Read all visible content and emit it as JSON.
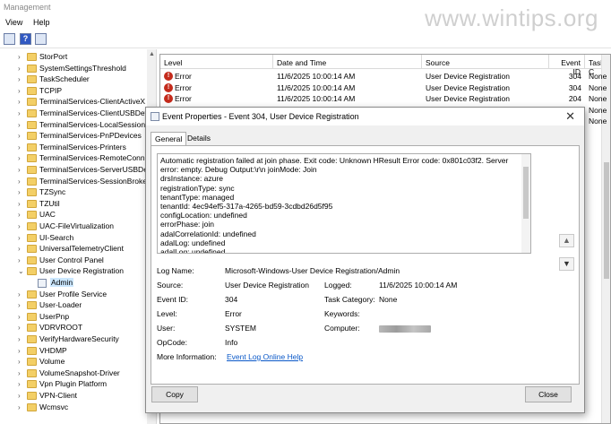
{
  "window": {
    "title": "Management"
  },
  "menu": {
    "view": "View",
    "help": "Help"
  },
  "watermark": "www.wintips.org",
  "tree": {
    "items": [
      {
        "label": "StorPort",
        "expanded": false
      },
      {
        "label": "SystemSettingsThreshold",
        "expanded": false
      },
      {
        "label": "TaskScheduler",
        "expanded": false
      },
      {
        "label": "TCPIP",
        "expanded": false
      },
      {
        "label": "TerminalServices-ClientActiveX",
        "expanded": false
      },
      {
        "label": "TerminalServices-ClientUSBDevi",
        "expanded": false
      },
      {
        "label": "TerminalServices-LocalSessionM",
        "expanded": false
      },
      {
        "label": "TerminalServices-PnPDevices",
        "expanded": false
      },
      {
        "label": "TerminalServices-Printers",
        "expanded": false
      },
      {
        "label": "TerminalServices-RemoteConne",
        "expanded": false
      },
      {
        "label": "TerminalServices-ServerUSBDev",
        "expanded": false
      },
      {
        "label": "TerminalServices-SessionBroker",
        "expanded": false
      },
      {
        "label": "TZSync",
        "expanded": false
      },
      {
        "label": "TZUtil",
        "expanded": false
      },
      {
        "label": "UAC",
        "expanded": false
      },
      {
        "label": "UAC-FileVirtualization",
        "expanded": false
      },
      {
        "label": "UI-Search",
        "expanded": false
      },
      {
        "label": "UniversalTelemetryClient",
        "expanded": false
      },
      {
        "label": "User Control Panel",
        "expanded": false
      },
      {
        "label": "User Device Registration",
        "expanded": true
      },
      {
        "label": "Admin",
        "child": true,
        "selected": true
      },
      {
        "label": "User Profile Service",
        "expanded": false
      },
      {
        "label": "User-Loader",
        "expanded": false
      },
      {
        "label": "UserPnp",
        "expanded": false
      },
      {
        "label": "VDRVROOT",
        "expanded": false
      },
      {
        "label": "VerifyHardwareSecurity",
        "expanded": false
      },
      {
        "label": "VHDMP",
        "expanded": false
      },
      {
        "label": "Volume",
        "expanded": false
      },
      {
        "label": "VolumeSnapshot-Driver",
        "expanded": false
      },
      {
        "label": "Vpn Plugin Platform",
        "expanded": false
      },
      {
        "label": "VPN-Client",
        "expanded": false
      },
      {
        "label": "Wcmsvc",
        "expanded": false
      }
    ]
  },
  "events": {
    "columns": [
      "Level",
      "Date and Time",
      "Source",
      "Event ID",
      "Task C"
    ],
    "rows": [
      {
        "level": "Error",
        "date": "11/6/2025 10:00:14 AM",
        "source": "User Device Registration",
        "id": "304",
        "task": "None"
      },
      {
        "level": "Error",
        "date": "11/6/2025 10:00:14 AM",
        "source": "User Device Registration",
        "id": "304",
        "task": "None"
      },
      {
        "level": "Error",
        "date": "11/6/2025 10:00:14 AM",
        "source": "User Device Registration",
        "id": "204",
        "task": "None"
      },
      {
        "level": "",
        "date": "",
        "source": "",
        "id": "",
        "task": "None"
      },
      {
        "level": "",
        "date": "",
        "source": "",
        "id": "",
        "task": "None"
      }
    ]
  },
  "dialog": {
    "title": "Event Properties - Event 304, User Device Registration",
    "tabs": [
      "General",
      "Details"
    ],
    "description_lines": [
      "Automatic registration failed at join phase.  Exit code: Unknown HResult Error code: 0x801c03f2. Server",
      "error: empty. Debug Output:\\r\\n joinMode: Join",
      "drsInstance: azure",
      "registrationType: sync",
      "tenantType: managed",
      "tenantId: 4ec94ef5-317a-4265-bd59-3cdbd26d5f95",
      "configLocation: undefined",
      "errorPhase: join",
      "adalCorrelationId: undefined",
      "adalLog: undefined",
      "adalLog: undefined"
    ],
    "props": {
      "log_name_label": "Log Name:",
      "log_name": "Microsoft-Windows-User Device Registration/Admin",
      "source_label": "Source:",
      "source": "User Device Registration",
      "logged_label": "Logged:",
      "logged": "11/6/2025 10:00:14 AM",
      "event_id_label": "Event ID:",
      "event_id": "304",
      "task_label": "Task Category:",
      "task": "None",
      "level_label": "Level:",
      "level": "Error",
      "keywords_label": "Keywords:",
      "keywords": "",
      "user_label": "User:",
      "user": "SYSTEM",
      "computer_label": "Computer:",
      "opcode_label": "OpCode:",
      "opcode": "Info",
      "more_info_label": "More Information:",
      "more_info_link": "Event Log Online Help"
    },
    "copy_label": "Copy",
    "close_label": "Close"
  }
}
